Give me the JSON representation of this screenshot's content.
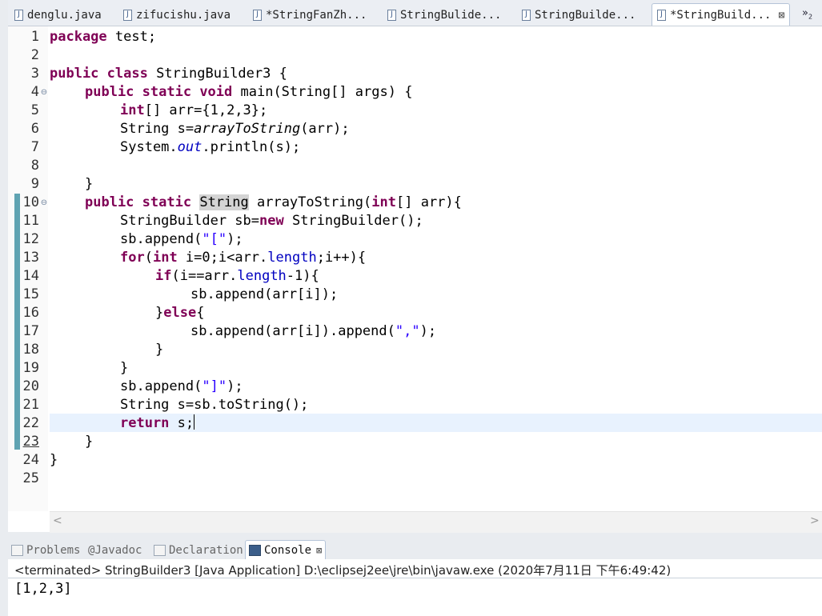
{
  "editor_tabs": [
    {
      "label": "denglu.java",
      "active": false
    },
    {
      "label": "zifucishu.java",
      "active": false
    },
    {
      "label": "*StringFanZh...",
      "active": false
    },
    {
      "label": "StringBulide...",
      "active": false
    },
    {
      "label": "StringBuilde...",
      "active": false
    },
    {
      "label": "*StringBuild...",
      "active": true
    }
  ],
  "tab_close_glyph": "⊠",
  "tab_overflow": {
    "glyph": "»",
    "count": "2"
  },
  "line_numbers": [
    "1",
    "2",
    "3",
    "4",
    "5",
    "6",
    "7",
    "8",
    "9",
    "10",
    "11",
    "12",
    "13",
    "14",
    "15",
    "16",
    "17",
    "18",
    "19",
    "20",
    "21",
    "22",
    "23",
    "24",
    "25"
  ],
  "fold_glyph": "⊖",
  "code": {
    "l1_package": "package",
    "l1_rest": " test;",
    "l3_public": "public",
    "l3_class": " class",
    "l3_rest": " StringBuilder3 {",
    "l4_public": "public",
    "l4_static": " static",
    "l4_void": " void",
    "l4_rest": " main(String[] args) {",
    "l5_int": "int",
    "l5_rest": "[] arr={1,2,3};",
    "l6_a": "String s=",
    "l6_method": "arrayToString",
    "l6_b": "(arr);",
    "l7_a": "System.",
    "l7_field": "out",
    "l7_b": ".println(s);",
    "l9": "}",
    "l10_public": "public",
    "l10_static": " static",
    "l10_sp": " ",
    "l10_type": "String",
    "l10_a": " arrayToString(",
    "l10_int": "int",
    "l10_b": "[] arr){",
    "l11_a": "StringBuilder sb=",
    "l11_new": "new",
    "l11_b": " StringBuilder();",
    "l12_a": "sb.append(",
    "l12_str": "\"[\"",
    "l12_b": ");",
    "l13_for": "for",
    "l13_a": "(",
    "l13_int": "int",
    "l13_b": " i=0;i<arr.",
    "l13_field": "length",
    "l13_c": ";i++){",
    "l14_if": "if",
    "l14_a": "(i==arr.",
    "l14_field": "length",
    "l14_b": "-1){",
    "l15": "sb.append(arr[i]);",
    "l16_a": "}",
    "l16_else": "else",
    "l16_b": "{",
    "l17_a": "sb.append(arr[i]).append(",
    "l17_str": "\",\"",
    "l17_b": ");",
    "l18": "}",
    "l19": "}",
    "l20_a": "sb.append(",
    "l20_str": "\"]\"",
    "l20_b": ");",
    "l21": "String s=sb.toString();",
    "l22_return": "return",
    "l22_rest": " s;",
    "l23": "}",
    "l24": "}"
  },
  "scroll": {
    "left": "<",
    "right": ">"
  },
  "view_tabs": [
    {
      "label": "Problems",
      "prefix": ""
    },
    {
      "label": "Javadoc",
      "prefix": "@ "
    },
    {
      "label": "Declaration",
      "prefix": ""
    },
    {
      "label": "Console",
      "prefix": ""
    }
  ],
  "console": {
    "status_line": "<terminated> StringBuilder3 [Java Application] D:\\eclipsej2ee\\jre\\bin\\javaw.exe (2020年7月11日 下午6:49:42)",
    "output": "[1,2,3]"
  },
  "colors": {
    "keyword": "#7f0055",
    "string": "#2a00ff",
    "field": "#0000c0",
    "change_bar": "#5fa3b2",
    "current_line": "#e8f2fe"
  }
}
